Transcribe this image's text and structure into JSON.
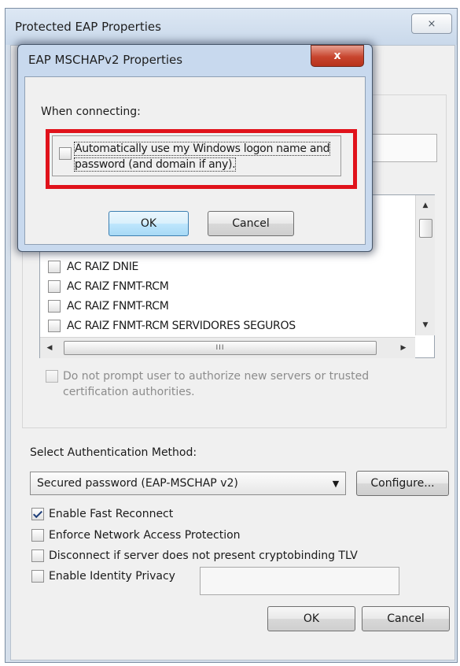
{
  "outer_dialog": {
    "title": "Protected EAP Properties",
    "close_glyph": "⨯",
    "certificates": [
      {
        "label": "AC RAIZ DNIE",
        "checked": false
      },
      {
        "label": "AC RAIZ FNMT-RCM",
        "checked": false
      },
      {
        "label": "AC RAIZ FNMT-RCM",
        "checked": false
      },
      {
        "label": "AC RAIZ FNMT-RCM SERVIDORES SEGUROS",
        "checked": false
      }
    ],
    "hscroll_grip": "III",
    "prompt_option": {
      "text": "Do not prompt user to authorize new servers or trusted certification authorities.",
      "checked": false,
      "enabled": false
    },
    "auth_method": {
      "label": "Select Authentication Method:",
      "selected": "Secured password (EAP-MSCHAP v2)",
      "configure_label": "Configure..."
    },
    "options": [
      {
        "label": "Enable Fast Reconnect",
        "checked": true
      },
      {
        "label": "Enforce Network Access Protection",
        "checked": false
      },
      {
        "label": "Disconnect if server does not present cryptobinding TLV",
        "checked": false
      },
      {
        "label": "Enable Identity Privacy",
        "checked": false
      }
    ],
    "ok_label": "OK",
    "cancel_label": "Cancel"
  },
  "inner_dialog": {
    "title": "EAP MSCHAPv2 Properties",
    "close_glyph": "x",
    "connecting_label": "When connecting:",
    "auto_logon": {
      "line1": "Automatically use my Windows logon name and",
      "line2": "password (and domain if any).",
      "checked": false
    },
    "ok_label": "OK",
    "cancel_label": "Cancel"
  },
  "colors": {
    "highlight": "#e0121b",
    "title_bar": "#c8d9ee",
    "close_button": "#c8452e"
  }
}
